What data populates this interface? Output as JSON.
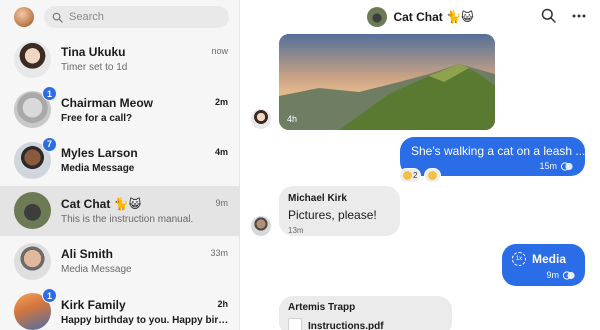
{
  "search": {
    "placeholder": "Search"
  },
  "conversations": [
    {
      "name": "Tina Ukuku",
      "snippet": "Timer set to 1d",
      "time": "now",
      "badge": "",
      "unread": false
    },
    {
      "name": "Chairman Meow",
      "snippet": "Free for a call?",
      "time": "2m",
      "badge": "1",
      "unread": true
    },
    {
      "name": "Myles Larson",
      "snippet": "Media Message",
      "time": "4m",
      "badge": "7",
      "unread": true
    },
    {
      "name": "Cat Chat 🐈😺",
      "snippet": "This is the instruction manual.",
      "time": "9m",
      "badge": "",
      "unread": false
    },
    {
      "name": "Ali Smith",
      "snippet": "Media Message",
      "time": "33m",
      "badge": "",
      "unread": false
    },
    {
      "name": "Kirk Family",
      "snippet": "Happy birthday to you. Happy birthday to you.",
      "time": "2h",
      "badge": "1",
      "unread": true
    }
  ],
  "chat": {
    "title": "Cat Chat 🐈😺",
    "photo": {
      "time": "4h"
    },
    "outgoing_1": {
      "text": "She's walking a cat on a leash ...",
      "time": "15m"
    },
    "reactions": [
      {
        "count": "2"
      },
      {
        "count": ""
      }
    ],
    "incoming_1": {
      "author": "Michael Kirk",
      "text": "Pictures, please!",
      "time": "13m"
    },
    "outgoing_2": {
      "badge": "1x",
      "text": "Media",
      "time": "9m"
    },
    "incoming_2": {
      "author": "Artemis Trapp",
      "file": "Instructions.pdf"
    }
  },
  "colors": {
    "accent": "#2a6de6",
    "incoming_bubble": "#ebebeb",
    "sidebar_bg": "#f6f6f6"
  },
  "icons": [
    "search-icon",
    "more-icon",
    "read-receipt-icon",
    "file-icon"
  ]
}
